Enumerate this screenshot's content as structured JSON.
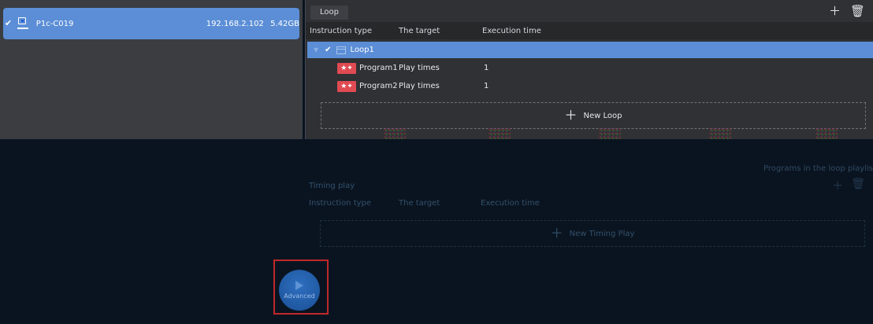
{
  "device": {
    "name": "P1c-C019",
    "ip": "192.168.2.102",
    "storage": "5.42GB"
  },
  "loop_panel": {
    "tab_label": "Loop",
    "columns": [
      "Instruction type",
      "The target",
      "Execution time"
    ],
    "loop_name": "Loop1",
    "programs": [
      {
        "name": "Program1",
        "target": "Play times",
        "exec": "1"
      },
      {
        "name": "Program2",
        "target": "Play times",
        "exec": "1"
      }
    ],
    "new_loop_label": "New Loop"
  },
  "timing_panel": {
    "note": "Programs in the loop playlis",
    "title": "Timing play",
    "columns": [
      "Instruction type",
      "The target",
      "Execution time"
    ],
    "new_timing_label": "New Timing Play"
  },
  "advanced": {
    "label": "Advanced"
  },
  "colors": {
    "selection": "#5b8ed6",
    "background": "#0a1420",
    "pane": "#2f3134",
    "program_icon": "#e04a52",
    "highlight_border": "#c0282a"
  }
}
